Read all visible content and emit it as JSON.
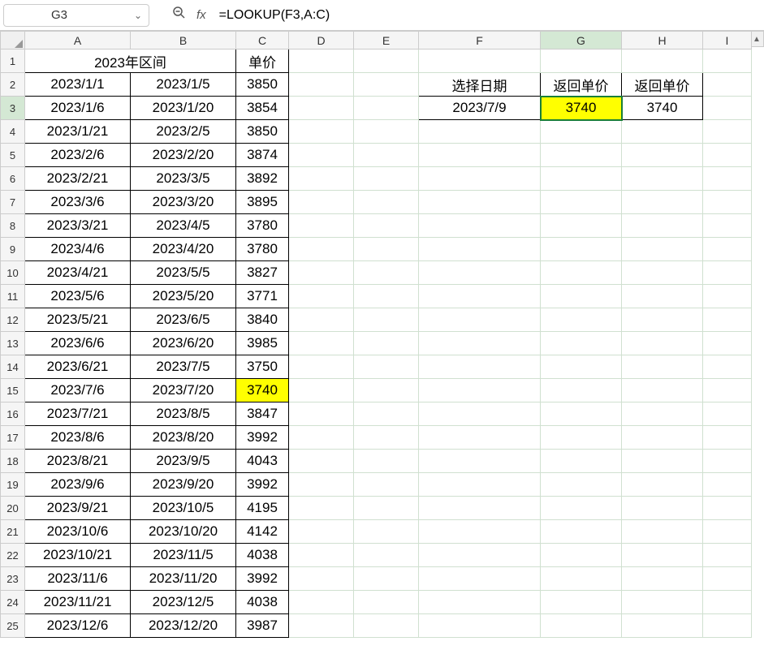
{
  "nameBox": "G3",
  "formula": "=LOOKUP(F3,A:C)",
  "columns": [
    "A",
    "B",
    "C",
    "D",
    "E",
    "F",
    "G",
    "H",
    "I"
  ],
  "selectedCell": {
    "row": 3,
    "col": "G"
  },
  "headers": {
    "AB1": "2023年区间",
    "C1": "单价",
    "F2": "选择日期",
    "G2": "返回单价",
    "H2": "返回单价"
  },
  "lookup": {
    "F3": "2023/7/9",
    "G3": "3740",
    "H3": "3740"
  },
  "dataTable": [
    {
      "start": "2023/1/1",
      "end": "2023/1/5",
      "price": "3850"
    },
    {
      "start": "2023/1/6",
      "end": "2023/1/20",
      "price": "3854"
    },
    {
      "start": "2023/1/21",
      "end": "2023/2/5",
      "price": "3850"
    },
    {
      "start": "2023/2/6",
      "end": "2023/2/20",
      "price": "3874"
    },
    {
      "start": "2023/2/21",
      "end": "2023/3/5",
      "price": "3892"
    },
    {
      "start": "2023/3/6",
      "end": "2023/3/20",
      "price": "3895"
    },
    {
      "start": "2023/3/21",
      "end": "2023/4/5",
      "price": "3780"
    },
    {
      "start": "2023/4/6",
      "end": "2023/4/20",
      "price": "3780"
    },
    {
      "start": "2023/4/21",
      "end": "2023/5/5",
      "price": "3827"
    },
    {
      "start": "2023/5/6",
      "end": "2023/5/20",
      "price": "3771"
    },
    {
      "start": "2023/5/21",
      "end": "2023/6/5",
      "price": "3840"
    },
    {
      "start": "2023/6/6",
      "end": "2023/6/20",
      "price": "3985"
    },
    {
      "start": "2023/6/21",
      "end": "2023/7/5",
      "price": "3750"
    },
    {
      "start": "2023/7/6",
      "end": "2023/7/20",
      "price": "3740",
      "highlight": true
    },
    {
      "start": "2023/7/21",
      "end": "2023/8/5",
      "price": "3847"
    },
    {
      "start": "2023/8/6",
      "end": "2023/8/20",
      "price": "3992"
    },
    {
      "start": "2023/8/21",
      "end": "2023/9/5",
      "price": "4043"
    },
    {
      "start": "2023/9/6",
      "end": "2023/9/20",
      "price": "3992"
    },
    {
      "start": "2023/9/21",
      "end": "2023/10/5",
      "price": "4195"
    },
    {
      "start": "2023/10/6",
      "end": "2023/10/20",
      "price": "4142"
    },
    {
      "start": "2023/10/21",
      "end": "2023/11/5",
      "price": "4038"
    },
    {
      "start": "2023/11/6",
      "end": "2023/11/20",
      "price": "3992"
    },
    {
      "start": "2023/11/21",
      "end": "2023/12/5",
      "price": "4038"
    },
    {
      "start": "2023/12/6",
      "end": "2023/12/20",
      "price": "3987"
    }
  ]
}
